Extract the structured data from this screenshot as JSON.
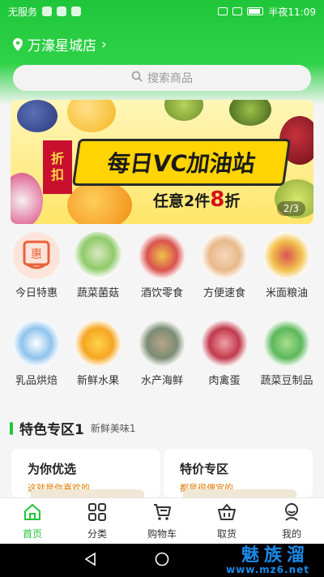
{
  "status_bar": {
    "carrier": "无服务",
    "time_label": "半夜11:09"
  },
  "header": {
    "store_name": "万濠星城店",
    "chevron": "›",
    "search_placeholder": "搜索商品"
  },
  "banner": {
    "tag_line1": "折",
    "tag_line2": "扣",
    "title": "每日VC加油站",
    "subtitle_prefix": "任意2件",
    "subtitle_number": "8",
    "subtitle_suffix": "折",
    "pager": "2/3"
  },
  "categories": [
    {
      "label": "今日特惠",
      "icon": "discount-icon",
      "color": "#f5b2a0"
    },
    {
      "label": "蔬菜菌菇",
      "icon": "vegetable-icon",
      "color": "#8fca6a"
    },
    {
      "label": "酒饮零食",
      "icon": "drinks-icon",
      "color": "#d9534f"
    },
    {
      "label": "方便速食",
      "icon": "instant-food-icon",
      "color": "#e8b98a"
    },
    {
      "label": "米面粮油",
      "icon": "grain-oil-icon",
      "color": "#f2c14e"
    },
    {
      "label": "乳品烘焙",
      "icon": "dairy-icon",
      "color": "#8fc3ec"
    },
    {
      "label": "新鲜水果",
      "icon": "fruit-icon",
      "color": "#f5a623"
    },
    {
      "label": "水产海鲜",
      "icon": "seafood-icon",
      "color": "#7c8b74"
    },
    {
      "label": "肉禽蛋",
      "icon": "meat-icon",
      "color": "#c0394b"
    },
    {
      "label": "蔬菜豆制品",
      "icon": "greens-icon",
      "color": "#5cb85c"
    }
  ],
  "section": {
    "title": "特色专区1",
    "subtitle": "新鲜美味1"
  },
  "cards": [
    {
      "title": "为你优选",
      "subtitle": "这就是你喜欢的"
    },
    {
      "title": "特价专区",
      "subtitle": "都是很便宜的"
    }
  ],
  "bottom_nav": [
    {
      "label": "首页",
      "icon": "home-icon",
      "active": true
    },
    {
      "label": "分类",
      "icon": "category-grid-icon",
      "active": false
    },
    {
      "label": "购物车",
      "icon": "cart-icon",
      "active": false
    },
    {
      "label": "取货",
      "icon": "basket-icon",
      "active": false
    },
    {
      "label": "我的",
      "icon": "profile-icon",
      "active": false
    }
  ],
  "watermark": {
    "line1": "魅族溜",
    "line2": "www.mz6.net"
  },
  "colors": {
    "brand_green": "#1fc63a",
    "banner_red": "#c8102e",
    "banner_yellow": "#ffd400",
    "promo_orange": "#e07b00"
  }
}
